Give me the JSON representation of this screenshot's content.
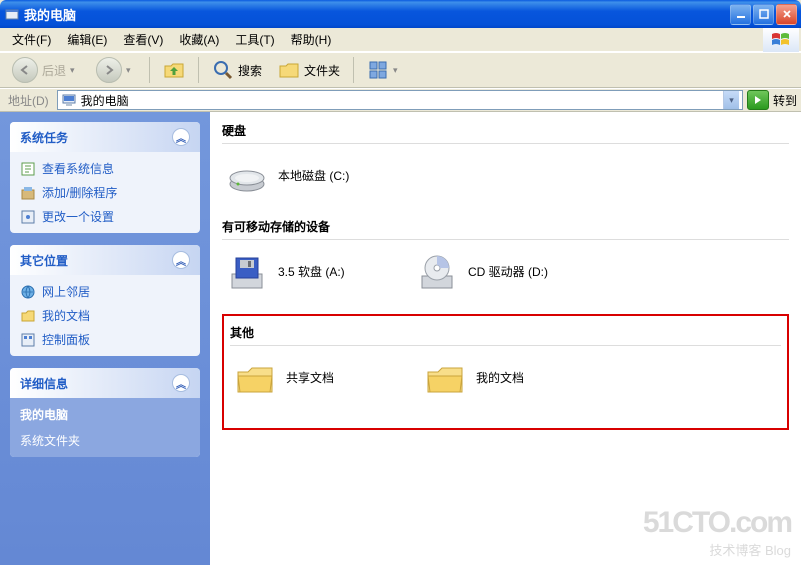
{
  "title": "我的电脑",
  "menu": {
    "file": "文件(F)",
    "edit": "编辑(E)",
    "view": "查看(V)",
    "fav": "收藏(A)",
    "tools": "工具(T)",
    "help": "帮助(H)"
  },
  "toolbar": {
    "back": "后退",
    "search": "搜索",
    "folders": "文件夹"
  },
  "addr": {
    "label": "地址(D)",
    "value": "我的电脑",
    "go": "转到"
  },
  "sidebar": {
    "tasks": {
      "title": "系统任务",
      "items": [
        "查看系统信息",
        "添加/删除程序",
        "更改一个设置"
      ]
    },
    "places": {
      "title": "其它位置",
      "items": [
        "网上邻居",
        "我的文档",
        "控制面板"
      ]
    },
    "details": {
      "title": "详细信息",
      "name": "我的电脑",
      "type": "系统文件夹"
    }
  },
  "content": {
    "s1": {
      "title": "硬盘",
      "items": [
        {
          "label": "本地磁盘 (C:)"
        }
      ]
    },
    "s2": {
      "title": "有可移动存储的设备",
      "items": [
        {
          "label": "3.5 软盘 (A:)"
        },
        {
          "label": "CD 驱动器 (D:)"
        }
      ]
    },
    "s3": {
      "title": "其他",
      "items": [
        {
          "label": "共享文档"
        },
        {
          "label": "我的文档"
        }
      ]
    }
  },
  "watermark": {
    "big": "51CTO.com",
    "small": "技术博客    Blog"
  }
}
